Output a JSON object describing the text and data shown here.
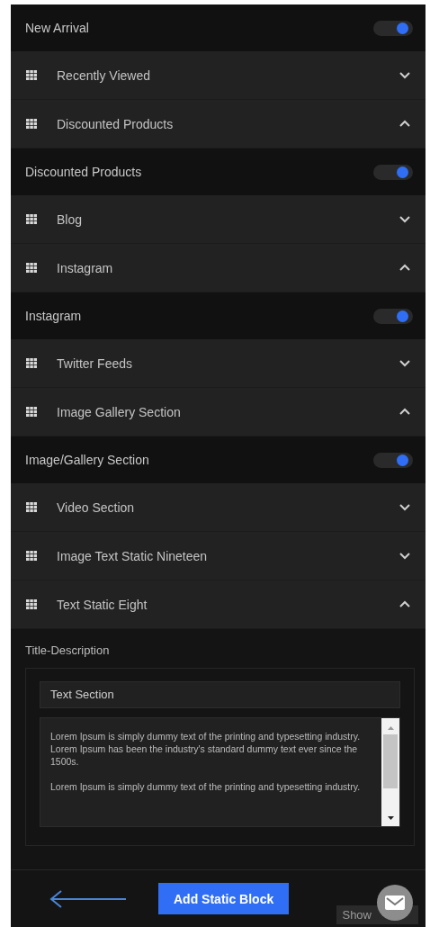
{
  "sections": [
    {
      "kind": "toggle",
      "label": "New Arrival",
      "on": true
    },
    {
      "kind": "accordion",
      "label": "Recently Viewed",
      "expanded": false
    },
    {
      "kind": "accordion",
      "label": "Discounted Products",
      "expanded": true
    },
    {
      "kind": "toggle",
      "label": "Discounted Products",
      "on": true
    },
    {
      "kind": "accordion",
      "label": "Blog",
      "expanded": false
    },
    {
      "kind": "accordion",
      "label": "Instagram",
      "expanded": true
    },
    {
      "kind": "toggle",
      "label": "Instagram",
      "on": true
    },
    {
      "kind": "accordion",
      "label": "Twitter Feeds",
      "expanded": false
    },
    {
      "kind": "accordion",
      "label": "Image Gallery Section",
      "expanded": true
    },
    {
      "kind": "toggle",
      "label": "Image/Gallery Section",
      "on": true
    },
    {
      "kind": "accordion",
      "label": "Video Section",
      "expanded": false
    },
    {
      "kind": "accordion",
      "label": "Image Text Static Nineteen",
      "expanded": false
    },
    {
      "kind": "accordion",
      "label": "Text Static Eight",
      "expanded": true
    }
  ],
  "editor": {
    "label": "Title-Description",
    "title_value": "Text Section",
    "description_value": "Lorem Ipsum is simply dummy text of the printing and typesetting industry. Lorem Ipsum has been the industry's standard dummy text ever since the 1500s.\n\nLorem Ipsum is simply dummy text of the printing and typesetting industry."
  },
  "footer": {
    "button": "Add Static Block",
    "tab_text": "Show"
  }
}
